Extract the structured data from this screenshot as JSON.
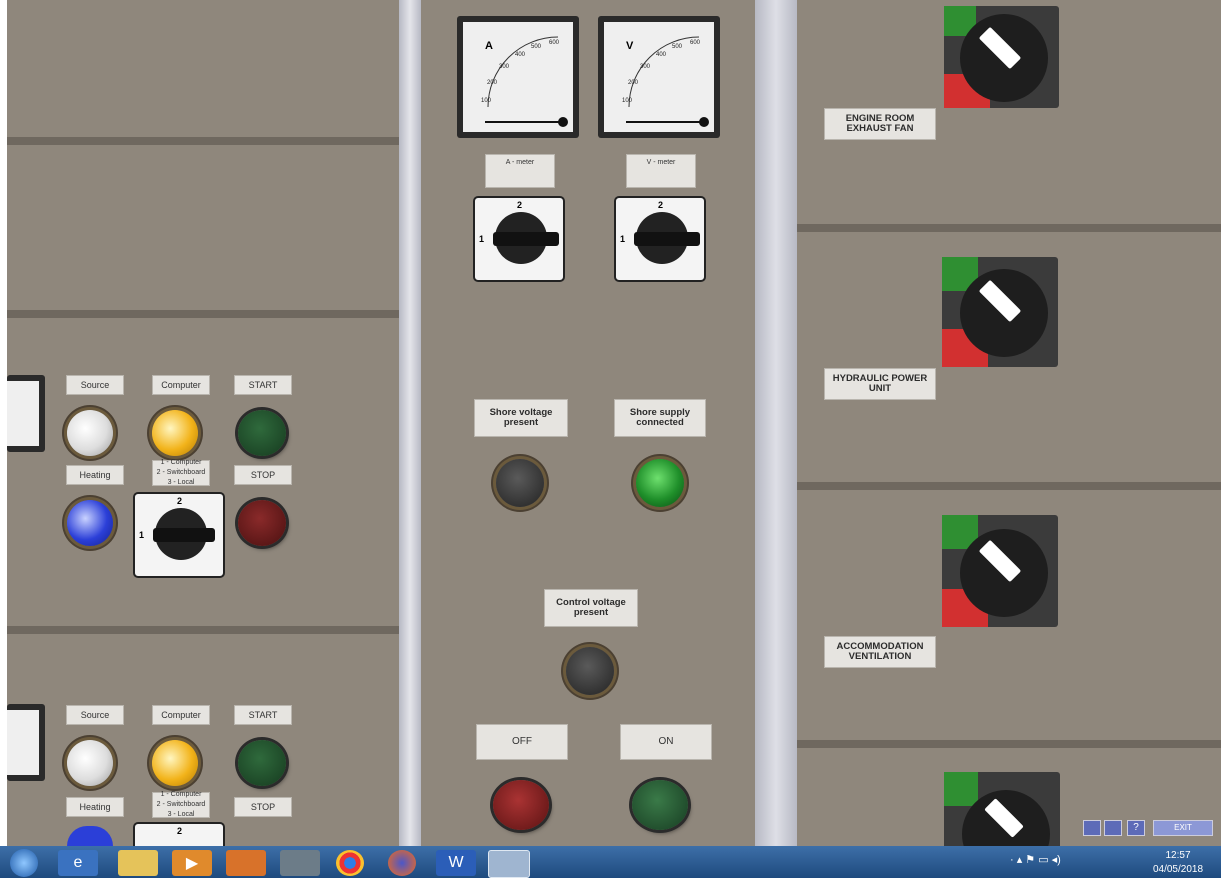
{
  "left_panel": {
    "row1": {
      "labels": {
        "source": "Source",
        "computer": "Computer",
        "start": "START",
        "heating": "Heating",
        "stop": "STOP"
      },
      "selector_label": "1 - Computer\n2 - Switchboard\n3 - Local",
      "selector_positions": {
        "top": "2",
        "left": "1"
      }
    },
    "row2": {
      "labels": {
        "source": "Source",
        "computer": "Computer",
        "start": "START",
        "heating": "Heating",
        "stop": "STOP"
      },
      "selector_label": "1 - Computer\n2 - Switchboard\n3 - Local",
      "selector_positions": {
        "top": "2"
      }
    }
  },
  "center_panel": {
    "ammeter": {
      "unit": "A",
      "scale": [
        "100",
        "200",
        "300",
        "400",
        "500",
        "600"
      ]
    },
    "voltmeter": {
      "unit": "V",
      "scale": [
        "100",
        "200",
        "300",
        "400",
        "500",
        "600"
      ]
    },
    "a_selector": {
      "label": "A - meter",
      "positions": {
        "top": "2",
        "left": "1"
      }
    },
    "v_selector": {
      "label": "V - meter",
      "positions": {
        "top": "2",
        "left": "1"
      }
    },
    "shore_voltage_label": "Shore voltage present",
    "shore_supply_label": "Shore supply connected",
    "control_voltage_label": "Control voltage present",
    "off_label": "OFF",
    "on_label": "ON"
  },
  "right_panel": {
    "units": [
      {
        "label": "ENGINE ROOM EXHAUST FAN"
      },
      {
        "label": "HYDRAULIC POWER UNIT"
      },
      {
        "label": "ACCOMMODATION VENTILATION"
      },
      {
        "label": ""
      }
    ]
  },
  "controls": {
    "exit_label": "EXIT",
    "help_label": "?"
  },
  "taskbar": {
    "time": "12:57",
    "date": "04/05/2018",
    "apps": [
      "start-icon",
      "ie-icon",
      "explorer-icon",
      "media-player-icon",
      "paint-icon",
      "calculator-icon",
      "chrome-icon",
      "firefox-icon",
      "word-icon",
      "app-icon"
    ]
  },
  "colors": {
    "panel": "#8f877c",
    "green_lamp": "#1f8f2a",
    "red_button": "#7a1c1c",
    "blue_lamp": "#2b3fd8",
    "yellow_lamp": "#f2b31a"
  }
}
